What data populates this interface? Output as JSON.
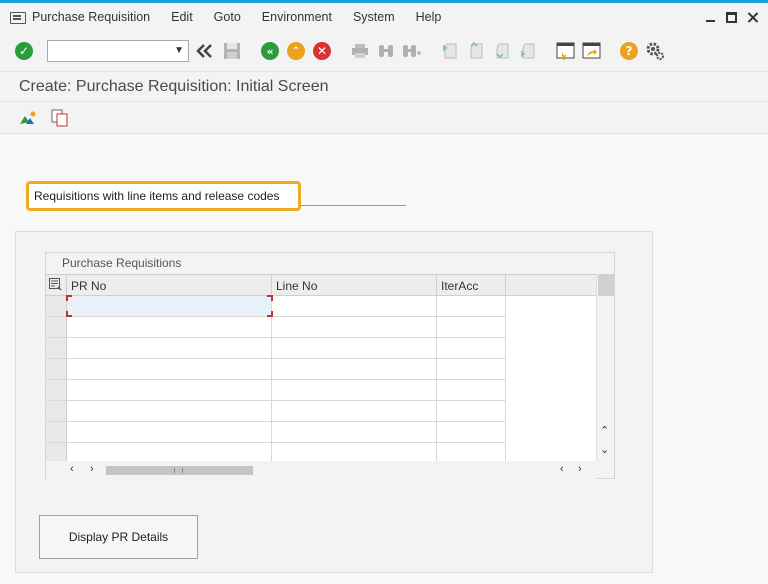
{
  "menubar": {
    "items": [
      "Purchase Requisition",
      "Edit",
      "Goto",
      "Environment",
      "System",
      "Help"
    ]
  },
  "toolbar": {
    "command_field": {
      "value": "",
      "placeholder": ""
    },
    "icons": [
      "enter-icon",
      "back-icon",
      "save-icon",
      "back-green-icon",
      "exit-icon",
      "cancel-icon",
      "print-icon",
      "find-icon",
      "find-next-icon",
      "first-page-icon",
      "prev-page-icon",
      "next-page-icon",
      "last-page-icon",
      "new-session-icon",
      "shortcut-icon",
      "help-icon",
      "settings-icon"
    ]
  },
  "title": {
    "text": "Create: Purchase Requisition: Initial Screen"
  },
  "app_toolbar": {
    "icons": [
      "other-document-icon",
      "copy-icon"
    ]
  },
  "banner": {
    "text": "Requisitions with line items and release codes"
  },
  "table": {
    "title": "Purchase Requisitions",
    "columns": [
      "PR No",
      "Line No",
      "IterAcc"
    ],
    "rows": [
      [
        "",
        "",
        ""
      ],
      [
        "",
        "",
        ""
      ],
      [
        "",
        "",
        ""
      ],
      [
        "",
        "",
        ""
      ],
      [
        "",
        "",
        ""
      ],
      [
        "",
        "",
        ""
      ],
      [
        "",
        "",
        ""
      ],
      [
        "",
        "",
        ""
      ]
    ]
  },
  "buttons": {
    "display_pr_details": "Display PR Details"
  },
  "colors": {
    "accent": "#1a9fd9",
    "highlight": "#f0a922",
    "green": "#2a9d3a",
    "orange": "#e9a321",
    "red": "#d83232"
  }
}
